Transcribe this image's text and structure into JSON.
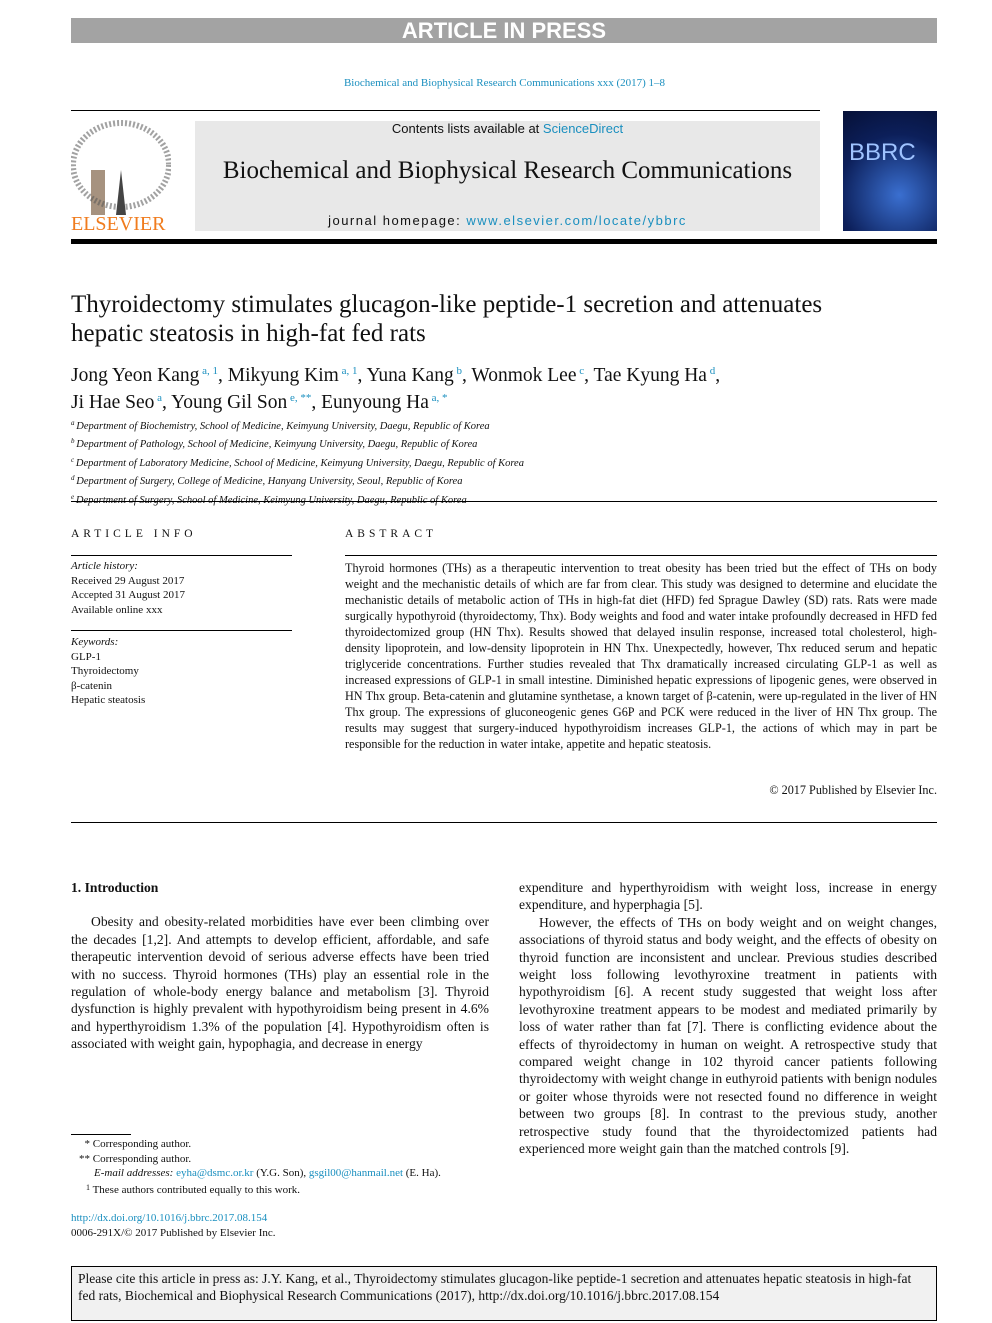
{
  "banner": "ARTICLE IN PRESS",
  "journal_ref": "Biochemical and Biophysical Research Communications xxx (2017) 1–8",
  "header": {
    "contents_prefix": "Contents lists available at ",
    "contents_link": "ScienceDirect",
    "journal_name": "Biochemical and Biophysical Research Communications",
    "homepage_prefix": "journal homepage: ",
    "homepage_url": "www.elsevier.com/locate/ybbrc",
    "publisher_logo": "ELSEVIER",
    "cover_title": "BBRC"
  },
  "article": {
    "title": "Thyroidectomy stimulates glucagon-like peptide-1 secretion and attenuates hepatic steatosis in high-fat fed rats",
    "authors": [
      {
        "name": "Jong Yeon Kang",
        "sup": "a, 1"
      },
      {
        "name": "Mikyung Kim",
        "sup": "a, 1"
      },
      {
        "name": "Yuna Kang",
        "sup": "b"
      },
      {
        "name": "Wonmok Lee",
        "sup": "c"
      },
      {
        "name": "Tae Kyung Ha",
        "sup": "d"
      },
      {
        "name": "Ji Hae Seo",
        "sup": "a"
      },
      {
        "name": "Young Gil Son",
        "sup": "e, **"
      },
      {
        "name": "Eunyoung Ha",
        "sup": "a, *"
      }
    ],
    "affiliations": [
      {
        "key": "a",
        "text": "Department of Biochemistry, School of Medicine, Keimyung University, Daegu, Republic of Korea"
      },
      {
        "key": "b",
        "text": "Department of Pathology, School of Medicine, Keimyung University, Daegu, Republic of Korea"
      },
      {
        "key": "c",
        "text": "Department of Laboratory Medicine, School of Medicine, Keimyung University, Daegu, Republic of Korea"
      },
      {
        "key": "d",
        "text": "Department of Surgery, College of Medicine, Hanyang University, Seoul, Republic of Korea"
      },
      {
        "key": "e",
        "text": "Department of Surgery, School of Medicine, Keimyung University, Daegu, Republic of Korea"
      }
    ]
  },
  "info": {
    "heading": "ARTICLE INFO",
    "history_label": "Article history:",
    "history": [
      "Received 29 August 2017",
      "Accepted 31 August 2017",
      "Available online xxx"
    ],
    "keywords_label": "Keywords:",
    "keywords": [
      "GLP-1",
      "Thyroidectomy",
      "β-catenin",
      "Hepatic steatosis"
    ]
  },
  "abstract": {
    "heading": "ABSTRACT",
    "text": "Thyroid hormones (THs) as a therapeutic intervention to treat obesity has been tried but the effect of THs on body weight and the mechanistic details of which are far from clear. This study was designed to determine and elucidate the mechanistic details of metabolic action of THs in high-fat diet (HFD) fed Sprague Dawley (SD) rats. Rats were made surgically hypothyroid (thyroidectomy, Thx). Body weights and food and water intake profoundly decreased in HFD fed thyroidectomized group (HN Thx). Results showed that delayed insulin response, increased total cholesterol, high-density lipoprotein, and low-density lipoprotein in HN Thx. Unexpectedly, however, Thx reduced serum and hepatic triglyceride concentrations. Further studies revealed that Thx dramatically increased circulating GLP-1 as well as increased expressions of GLP-1 in small intestine. Diminished hepatic expressions of lipogenic genes, were observed in HN Thx group. Beta-catenin and glutamine synthetase, a known target of β-catenin, were up-regulated in the liver of HN Thx group. The expressions of gluconeogenic genes G6P and PCK were reduced in the liver of HN Thx group. The results may suggest that surgery-induced hypothyroidism increases GLP-1, the actions of which may in part be responsible for the reduction in water intake, appetite and hepatic steatosis.",
    "copyright": "© 2017 Published by Elsevier Inc."
  },
  "intro": {
    "heading": "1.  Introduction",
    "p1": "Obesity and obesity-related morbidities have ever been climbing over the decades [1,2]. And attempts to develop efficient, affordable, and safe therapeutic intervention devoid of serious adverse effects have been tried with no success. Thyroid hormones (THs) play an essential role in the regulation of whole-body energy balance and metabolism [3]. Thyroid dysfunction is highly prevalent with hypothyroidism being present in 4.6% and hyperthyroidism 1.3% of the population [4]. Hypothyroidism often is associated with weight gain, hypophagia, and decrease in energy",
    "p1b": "expenditure and hyperthyroidism with weight loss, increase in energy expenditure, and hyperphagia [5].",
    "p2": "However, the effects of THs on body weight and on weight changes, associations of thyroid status and body weight, and the effects of obesity on thyroid function are inconsistent and unclear. Previous studies described weight loss following levothyroxine treatment in patients with hypothyroidism [6]. A recent study suggested that weight loss after levothyroxine treatment appears to be modest and mediated primarily by loss of water rather than fat [7]. There is conflicting evidence about the effects of thyroidectomy in human on weight. A retrospective study that compared weight change in 102 thyroid cancer patients following thyroidectomy with weight change in euthyroid patients with benign nodules or goiter whose thyroids were not resected found no difference in weight between two groups [8]. In contrast to the previous study, another retrospective study found that the thyroidectomized patients had experienced more weight gain than the matched controls [9]."
  },
  "footnotes": {
    "star": "*",
    "star_text": "Corresponding author.",
    "dstar": "**",
    "dstar_text": "Corresponding author.",
    "email_label": "E-mail addresses: ",
    "email1": "eyha@dsmc.or.kr",
    "email1_who": " (Y.G. Son), ",
    "email2": "gsgil00@hanmail.net",
    "email2_who": " (E. Ha).",
    "one": "1",
    "one_text": "These authors contributed equally to this work.",
    "doi": "http://dx.doi.org/10.1016/j.bbrc.2017.08.154",
    "issn": "0006-291X/© 2017 Published by Elsevier Inc."
  },
  "citation": "Please cite this article in press as: J.Y. Kang, et al., Thyroidectomy stimulates glucagon-like peptide-1 secretion and attenuates hepatic steatosis in high-fat fed rats, Biochemical and Biophysical Research Communications (2017), http://dx.doi.org/10.1016/j.bbrc.2017.08.154"
}
